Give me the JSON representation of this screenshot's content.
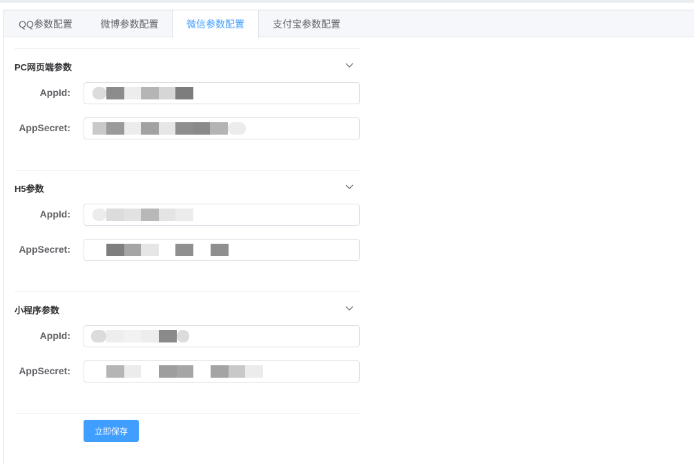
{
  "tabs": [
    "QQ参数配置",
    "微博参数配置",
    "微信参数配置",
    "支付宝参数配置"
  ],
  "active_tab": 2,
  "sections": [
    {
      "title": "PC网页端参数",
      "appid_label": "AppId:",
      "secret_label": "AppSecret:",
      "appid_value": "",
      "secret_value": ""
    },
    {
      "title": "H5参数",
      "appid_label": "AppId:",
      "secret_label": "AppSecret:",
      "appid_value": "",
      "secret_value": ""
    },
    {
      "title": "小程序参数",
      "appid_label": "AppId:",
      "secret_label": "AppSecret:",
      "appid_value": "",
      "secret_value": ""
    }
  ],
  "save_button": "立即保存",
  "colors": {
    "accent": "#409eff",
    "border": "#dcdfe6",
    "tab_bg": "#f5f7fa"
  },
  "icons": {
    "collapse": "chevron-down-icon"
  }
}
